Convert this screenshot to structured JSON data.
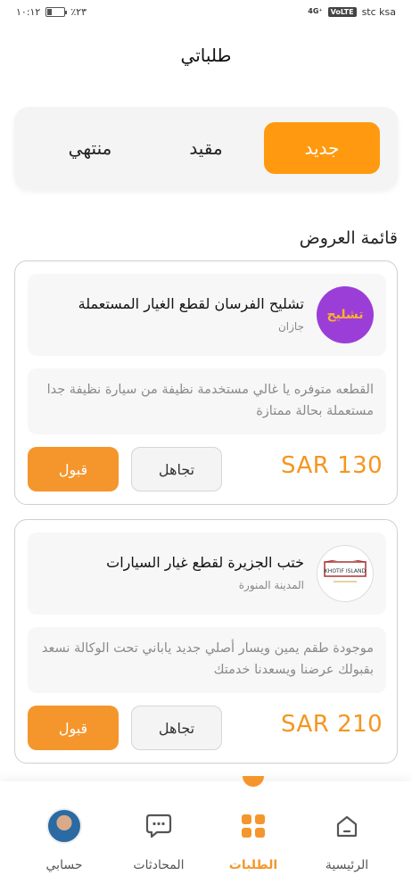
{
  "status_bar": {
    "time": "١٠:١٢",
    "battery": "٪٢٣",
    "battery_level": 0.23,
    "network": "4G⁺",
    "volte": "VoLTE",
    "carrier": "stc ksa"
  },
  "header": {
    "title": "طلباتي"
  },
  "tabs": [
    {
      "label": "جديد",
      "active": true
    },
    {
      "label": "مقيد",
      "active": false
    },
    {
      "label": "منتهي",
      "active": false
    }
  ],
  "offers_section": {
    "title": "قائمة العروض"
  },
  "offers": [
    {
      "shop_name": "تشليح الفرسان لقطع الغيار المستعملة",
      "city": "جازان",
      "logo_text": "تشليح",
      "description": "القطعه متوفره يا غالي مستخدمة نظيفة من سيارة نظيفة جدا مستعملة بحالة ممتازة",
      "price": "SAR 130",
      "ignore_label": "تجاهل",
      "accept_label": "قبول"
    },
    {
      "shop_name": "ختب الجزيرة لقطع غيار السيارات",
      "city": "المدينة المنورة",
      "logo_text": "KHOTIF ISLAND",
      "description": "موجودة طقم يمين ويسار أصلي جديد ياباني تحت الوكالة نسعد بقبولك عرضنا ويسعدنا خدمتك",
      "price": "SAR 210",
      "ignore_label": "تجاهل",
      "accept_label": "قبول"
    }
  ],
  "bottom_nav": [
    {
      "label": "الرئيسية",
      "icon": "home-icon",
      "active": false
    },
    {
      "label": "الطلبات",
      "icon": "grid-icon",
      "active": true
    },
    {
      "label": "المحادثات",
      "icon": "chat-icon",
      "active": false
    },
    {
      "label": "حسابي",
      "icon": "avatar",
      "active": false
    }
  ],
  "colors": {
    "accent": "#f4962c",
    "tab_active": "#ff9a10"
  }
}
